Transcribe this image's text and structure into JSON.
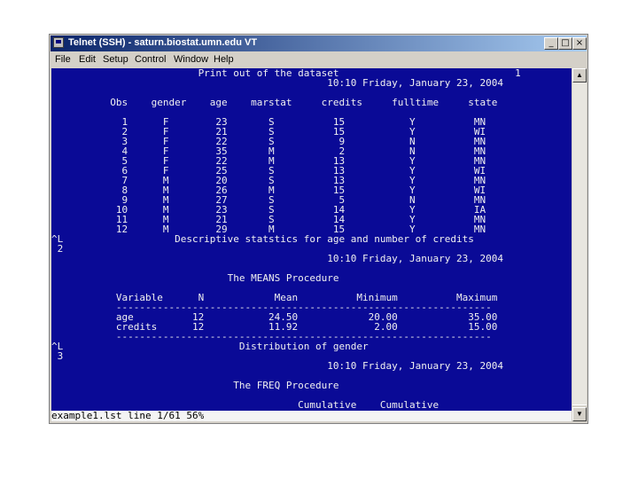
{
  "window": {
    "title": "Telnet (SSH) - saturn.biostat.umn.edu VT",
    "controls": {
      "minimize": "_",
      "maximize": "□",
      "close": "×"
    }
  },
  "menubar": [
    "File",
    "Edit",
    "Setup",
    "Control",
    "Window",
    "Help"
  ],
  "terminal": {
    "lines": [
      "                         Print out of the dataset                              1",
      "                                               10:10 Friday, January 23, 2004",
      "",
      "          Obs    gender    age    marstat     credits     fulltime     state",
      "",
      "            1      F        23       S          15           Y          MN",
      "            2      F        21       S          15           Y          WI",
      "            3      F        22       S           9           N          MN",
      "            4      F        35       M           2           N          MN",
      "            5      F        22       M          13           Y          MN",
      "            6      F        25       S          13           Y          WI",
      "            7      M        20       S          13           Y          MN",
      "            8      M        26       M          15           Y          WI",
      "            9      M        27       S           5           N          MN",
      "           10      M        23       S          14           Y          IA",
      "           11      M        21       S          14           Y          MN",
      "           12      M        29       M          15           Y          MN",
      "^L                   Descriptive statstics for age and number of credits",
      " 2",
      "                                               10:10 Friday, January 23, 2004",
      "",
      "                              The MEANS Procedure",
      "",
      "           Variable      N            Mean          Minimum          Maximum",
      "           ----------------------------------------------------------------",
      "           age          12           24.50            20.00            35.00",
      "           credits      12           11.92             2.00            15.00",
      "           ----------------------------------------------------------------",
      "^L                              Distribution of gender",
      " 3",
      "                                               10:10 Friday, January 23, 2004",
      "",
      "                               The FREQ Procedure",
      "",
      "                                          Cumulative    Cumulative"
    ],
    "status": "example1.lst line 1/61 56%"
  },
  "scrollbar": {
    "up": "▲",
    "down": "▼"
  }
}
